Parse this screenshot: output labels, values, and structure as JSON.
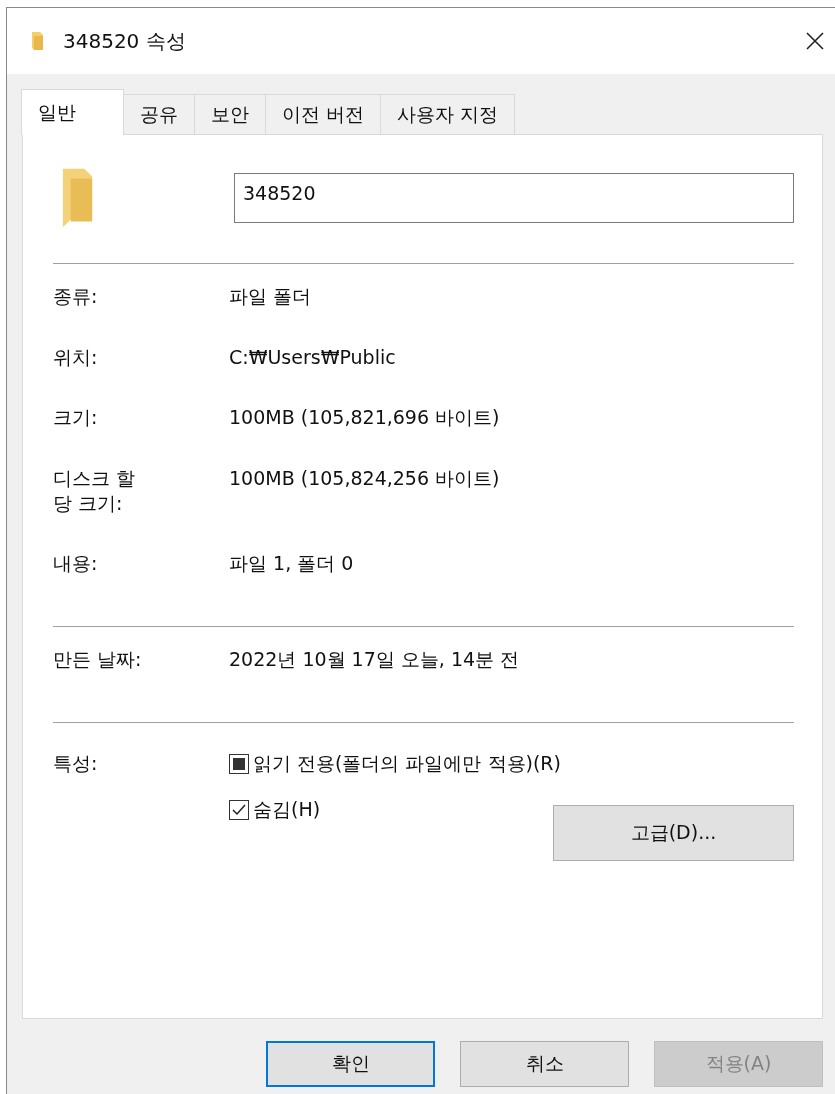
{
  "window": {
    "title": "348520 속성"
  },
  "tabs": [
    {
      "label": "일반",
      "selected": true
    },
    {
      "label": "공유",
      "selected": false
    },
    {
      "label": "보안",
      "selected": false
    },
    {
      "label": "이전 버전",
      "selected": false
    },
    {
      "label": "사용자 지정",
      "selected": false
    }
  ],
  "name_field": {
    "value": "348520"
  },
  "sections": [
    [
      {
        "label": "종류:",
        "value": "파일 폴더"
      },
      {
        "label": "위치:",
        "value": "C:₩Users₩Public"
      },
      {
        "label": "크기:",
        "value": "100MB (105,821,696 바이트)"
      },
      {
        "label": "디스크 할\n당 크기:",
        "value": "100MB (105,824,256 바이트)"
      },
      {
        "label": "내용:",
        "value": "파일 1, 폴더 0"
      }
    ],
    [
      {
        "label": "만든 날짜:",
        "value": "2022년 10월 17일 오늘, 14분 전"
      }
    ]
  ],
  "attributes": {
    "label": "특성:",
    "options": [
      {
        "label": "읽기 전용(폴더의 파일에만 적용)(R)",
        "checked": false,
        "mixed": true
      },
      {
        "label": "숨김(H)",
        "checked": true
      }
    ],
    "advanced_button": "고급(D)..."
  },
  "buttons": [
    {
      "label": "확인",
      "default": true,
      "disabled": false
    },
    {
      "label": "취소",
      "default": false,
      "disabled": false
    },
    {
      "label": "적용(A)",
      "default": false,
      "disabled": true
    }
  ]
}
